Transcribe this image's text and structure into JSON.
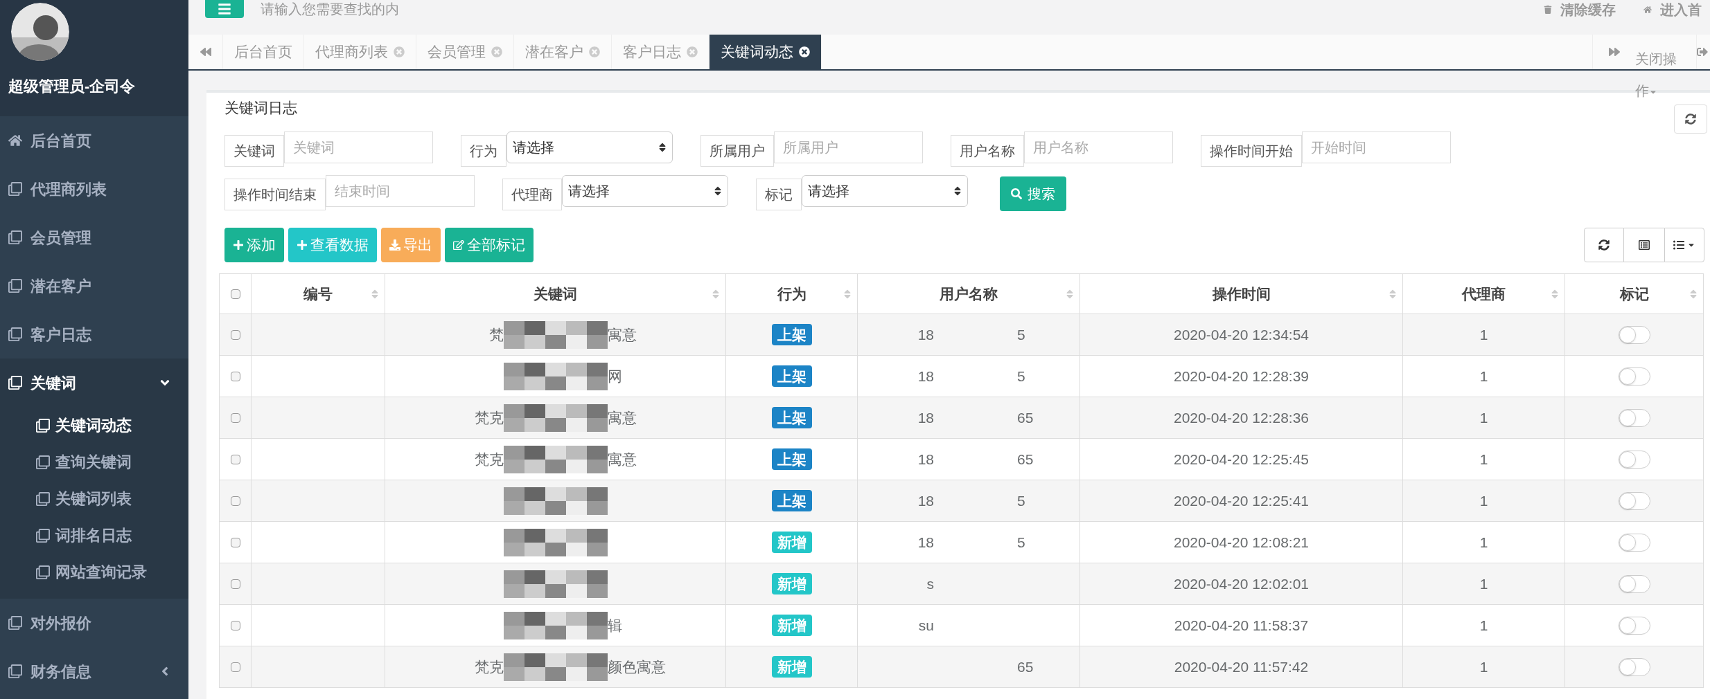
{
  "profile": {
    "name": "超级管理员-企司令"
  },
  "sidebar": {
    "items": [
      {
        "label": "后台首页",
        "kind": "link"
      },
      {
        "label": "代理商列表",
        "kind": "link"
      },
      {
        "label": "会员管理",
        "kind": "link"
      },
      {
        "label": "潜在客户",
        "kind": "link"
      },
      {
        "label": "客户日志",
        "kind": "link"
      },
      {
        "label": "关键词",
        "kind": "group",
        "expanded": true,
        "children": [
          {
            "label": "关键词动态",
            "selected": true
          },
          {
            "label": "查询关键词",
            "selected": false
          },
          {
            "label": "关键词列表",
            "selected": false
          },
          {
            "label": "词排名日志",
            "selected": false
          },
          {
            "label": "网站查询记录",
            "selected": false
          }
        ]
      },
      {
        "label": "对外报价",
        "kind": "link"
      },
      {
        "label": "财务信息",
        "kind": "group",
        "expanded": false
      }
    ]
  },
  "topbar": {
    "search_placeholder": "请输入您需要查找的内",
    "links": [
      "清除缓存",
      "进入首"
    ]
  },
  "tabs": [
    {
      "label": "后台首页",
      "selected": false,
      "closable": false
    },
    {
      "label": "代理商列表",
      "selected": false,
      "closable": true
    },
    {
      "label": "会员管理",
      "selected": false,
      "closable": true
    },
    {
      "label": "潜在客户",
      "selected": false,
      "closable": true
    },
    {
      "label": "客户日志",
      "selected": false,
      "closable": true
    },
    {
      "label": "关键词动态",
      "selected": true,
      "closable": true
    }
  ],
  "close_menu": "关闭操作",
  "panel": {
    "title": "关键词日志"
  },
  "filters": [
    {
      "label": "关键词",
      "kind": "input",
      "placeholder": "关键词"
    },
    {
      "label": "行为",
      "kind": "select",
      "value": "请选择"
    },
    {
      "label": "所属用户",
      "kind": "input",
      "placeholder": "所属用户"
    },
    {
      "label": "用户名称",
      "kind": "input",
      "placeholder": "用户名称"
    },
    {
      "label": "操作时间开始",
      "kind": "input",
      "placeholder": "开始时间"
    },
    {
      "label": "操作时间结束",
      "kind": "input",
      "placeholder": "结束时间"
    },
    {
      "label": "代理商",
      "kind": "select",
      "value": "请选择"
    },
    {
      "label": "标记",
      "kind": "select",
      "value": "请选择"
    }
  ],
  "search_button": "搜索",
  "actions": [
    {
      "label": "添加",
      "kind": "add"
    },
    {
      "label": "查看数据",
      "kind": "view"
    },
    {
      "label": "导出",
      "kind": "export"
    },
    {
      "label": "全部标记",
      "kind": "mark"
    }
  ],
  "table": {
    "all_checked": false,
    "columns": [
      "编号",
      "关键词",
      "行为",
      "用户名称",
      "操作时间",
      "代理商",
      "标记"
    ],
    "rows": [
      {
        "checked": false,
        "keyword_start": "梵",
        "keyword_end": "寓意",
        "action": {
          "label": "上架",
          "kind": "shelf"
        },
        "user_start": "18",
        "user_end": "5",
        "time": "2020-04-20 12:34:54",
        "agent": "1",
        "marked": false
      },
      {
        "checked": false,
        "keyword_end": "网",
        "action": {
          "label": "上架",
          "kind": "shelf"
        },
        "user_start": "18",
        "user_end": "5",
        "time": "2020-04-20 12:28:39",
        "agent": "1",
        "marked": false
      },
      {
        "checked": false,
        "keyword_start": "梵克",
        "keyword_end": "寓意",
        "action": {
          "label": "上架",
          "kind": "shelf"
        },
        "user_start": "18",
        "user_end": "65",
        "time": "2020-04-20 12:28:36",
        "agent": "1",
        "marked": false
      },
      {
        "checked": false,
        "keyword_start": "梵克",
        "keyword_end": "寓意",
        "action": {
          "label": "上架",
          "kind": "shelf"
        },
        "user_start": "18",
        "user_end": "65",
        "time": "2020-04-20 12:25:45",
        "agent": "1",
        "marked": false
      },
      {
        "checked": false,
        "action": {
          "label": "上架",
          "kind": "shelf"
        },
        "user_start": "18",
        "user_end": "5",
        "time": "2020-04-20 12:25:41",
        "agent": "1",
        "marked": false
      },
      {
        "checked": false,
        "action": {
          "label": "新增",
          "kind": "new"
        },
        "user_start": "18",
        "user_end": "5",
        "time": "2020-04-20 12:08:21",
        "agent": "1",
        "marked": false
      },
      {
        "checked": false,
        "action": {
          "label": "新增",
          "kind": "new"
        },
        "user_start": "s",
        "time": "2020-04-20 12:02:01",
        "agent": "1",
        "marked": false
      },
      {
        "checked": false,
        "keyword_end": "辑",
        "action": {
          "label": "新增",
          "kind": "new"
        },
        "user_start": "su",
        "time": "2020-04-20 11:58:37",
        "agent": "1",
        "marked": false
      },
      {
        "checked": false,
        "keyword_start": "梵克",
        "keyword_end": "颜色寓意",
        "action": {
          "label": "新增",
          "kind": "new"
        },
        "user_end": "65",
        "time": "2020-04-20 11:57:42",
        "agent": "1",
        "marked": false
      }
    ]
  }
}
